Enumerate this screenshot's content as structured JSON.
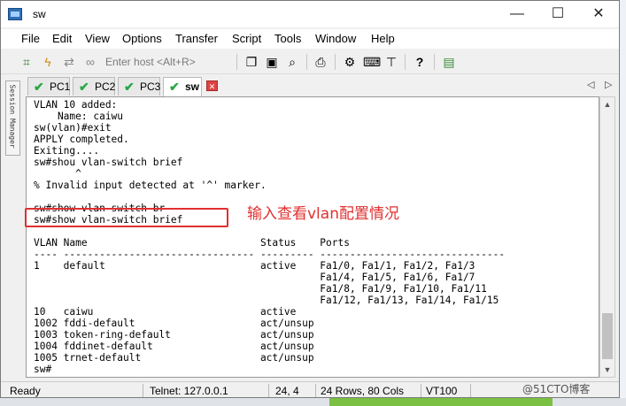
{
  "window": {
    "title": "sw"
  },
  "window_controls": {
    "minimize": "—",
    "maximize": "☐",
    "close": "✕"
  },
  "menu": [
    "File",
    "Edit",
    "View",
    "Options",
    "Transfer",
    "Script",
    "Tools",
    "Window",
    "Help"
  ],
  "toolbar": {
    "host_placeholder": "Enter host <Alt+R>",
    "icons": [
      "connect-icon",
      "quick-connect-icon",
      "reconnect-icon",
      "disconnect-icon",
      "copy-icon",
      "paste-icon",
      "find-icon",
      "print-icon",
      "settings-icon",
      "keymap-icon",
      "sftp-icon",
      "help-icon",
      "screen-icon"
    ]
  },
  "sidebar": {
    "session_manager_label": "Session Manager"
  },
  "tabs": [
    {
      "label": "PC1",
      "connected": true,
      "active": false
    },
    {
      "label": "PC2",
      "connected": true,
      "active": false
    },
    {
      "label": "PC3",
      "connected": true,
      "active": false
    },
    {
      "label": "sw",
      "connected": true,
      "active": true
    }
  ],
  "tab_close": "✕",
  "tab_nav": {
    "prev": "◁",
    "next": "▷"
  },
  "terminal": {
    "lines": [
      "VLAN 10 added:",
      "    Name: caiwu",
      "sw(vlan)#exit",
      "APPLY completed.",
      "Exiting....",
      "sw#shou vlan-switch brief",
      "       ^",
      "% Invalid input detected at '^' marker.",
      "",
      "sw#show vlan-switch br",
      "sw#show vlan-switch brief",
      "",
      "VLAN Name                             Status    Ports",
      "---- -------------------------------- --------- -------------------------------",
      "1    default                          active    Fa1/0, Fa1/1, Fa1/2, Fa1/3",
      "                                                Fa1/4, Fa1/5, Fa1/6, Fa1/7",
      "                                                Fa1/8, Fa1/9, Fa1/10, Fa1/11",
      "                                                Fa1/12, Fa1/13, Fa1/14, Fa1/15",
      "10   caiwu                            active",
      "1002 fddi-default                     act/unsup",
      "1003 token-ring-default               act/unsup",
      "1004 fddinet-default                  act/unsup",
      "1005 trnet-default                    act/unsup",
      "sw#"
    ]
  },
  "annotation": {
    "text": "输入查看vlan配置情况",
    "color": "#e03030"
  },
  "statusbar": {
    "ready": "Ready",
    "telnet": "Telnet: 127.0.0.1",
    "cursor": "24,  4",
    "size": "24 Rows, 80 Cols",
    "terminal_type": "VT100"
  },
  "watermark": "@51CTO博客"
}
